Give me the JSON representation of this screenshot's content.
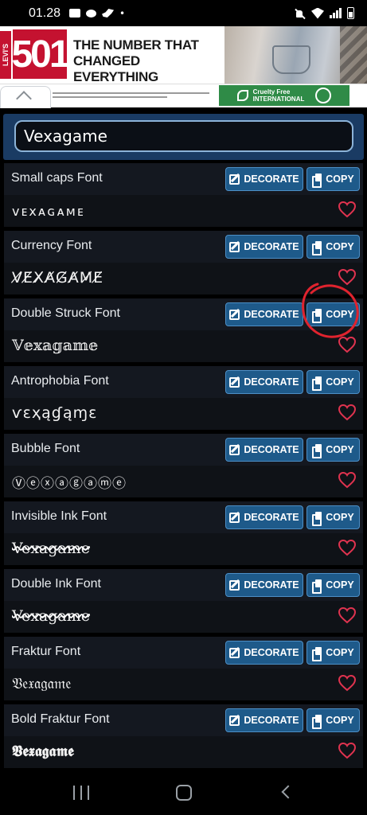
{
  "status_bar": {
    "time": "01.28",
    "dot": "•"
  },
  "ad": {
    "brand_tab": "LEVI'S",
    "model": "501",
    "headline_line1": "THE NUMBER THAT",
    "headline_line2": "CHANGED EVERYTHING",
    "badge_line1": "Cruelty Free",
    "badge_line2": "INTERNATIONAL"
  },
  "search": {
    "value": "Vexagame"
  },
  "buttons": {
    "decorate_label": "DECORATE",
    "copy_label": "COPY"
  },
  "fonts": [
    {
      "name": "Small caps Font",
      "sample": "ᴠᴇxᴀɢᴀᴍᴇ"
    },
    {
      "name": "Currency Font",
      "sample": "V̸E̸X̸A̸G̸A̸M̸E̸"
    },
    {
      "name": "Double Struck Font",
      "sample": "𝕍𝕖𝕩𝕒𝕘𝕒𝕞𝕖"
    },
    {
      "name": "Antrophobia Font",
      "sample": "ѵɛҳąɠąɱɛ"
    },
    {
      "name": "Bubble Font",
      "sample": "Ⓥⓔⓧⓐⓖⓐⓜⓔ"
    },
    {
      "name": "Invisible Ink Font",
      "sample": "Vexagame"
    },
    {
      "name": "Double Ink Font",
      "sample": "Vexagame"
    },
    {
      "name": "Fraktur Font",
      "sample": "𝔙𝔢𝔵𝔞𝔤𝔞𝔪𝔢"
    },
    {
      "name": "Bold Fraktur Font",
      "sample": "𝖁𝖊𝖝𝖆𝖌𝖆𝖒𝖊"
    }
  ],
  "colors": {
    "card_bg": "#0f1217",
    "button_bg": "#1e5a8a",
    "heart": "#e0334f",
    "annotation": "#e0232e",
    "search_frame": "#1a3b63"
  },
  "icons": {
    "decorate": "edit-icon",
    "copy": "copy-icon",
    "favorite": "heart-icon",
    "annotation": "red-circle-annotation"
  }
}
